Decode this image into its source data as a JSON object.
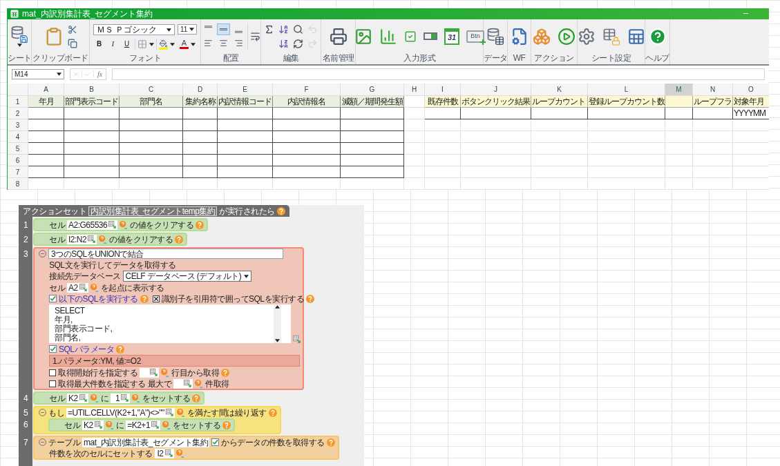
{
  "window": {
    "title": "mat_内訳別集計表_セグメント集約"
  },
  "ribbon": {
    "groups": [
      {
        "kind": "sheet",
        "label": "シート",
        "tools": [
          {
            "kind": "db_save"
          }
        ]
      },
      {
        "kind": "clipboard",
        "label": "クリップボード",
        "tools": [
          {
            "kind": "paste"
          },
          {
            "kind": "cut"
          },
          {
            "kind": "copy"
          }
        ]
      },
      {
        "kind": "font",
        "label": "フォント",
        "font_name": "ＭＳ Ｐゴシック",
        "font_size": "11",
        "styles": [
          "B",
          "I",
          "U"
        ],
        "font_color_glyph": "A"
      },
      {
        "kind": "align",
        "label": "配置",
        "alignments": [
          {
            "selected": false
          },
          {
            "selected": true
          },
          {
            "selected": false
          },
          {
            "selected": false
          },
          {
            "selected": false
          },
          {
            "selected": false
          }
        ]
      },
      {
        "kind": "edit",
        "label": "編集",
        "tools": [
          {
            "kind": "sum",
            "disabled": false
          },
          {
            "kind": "sort_asc",
            "disabled": false
          },
          {
            "kind": "find",
            "disabled": false
          },
          {
            "kind": "undo",
            "disabled": true
          },
          {
            "kind": "sort_desc",
            "disabled": false
          },
          {
            "kind": "refresh",
            "disabled": false
          },
          {
            "kind": "redo",
            "disabled": true
          }
        ]
      },
      {
        "kind": "names",
        "label": "名前管理",
        "tools": [
          {
            "kind": "names"
          }
        ]
      },
      {
        "kind": "input",
        "label": "入力形式",
        "tools": [
          {
            "kind": "image"
          },
          {
            "kind": "chart"
          },
          {
            "kind": "check"
          },
          {
            "kind": "combo"
          },
          {
            "kind": "calendar",
            "text": "31"
          },
          {
            "kind": "button",
            "text": "Btn"
          }
        ]
      },
      {
        "kind": "data",
        "label": "データ",
        "tools": [
          {
            "kind": "database"
          }
        ]
      },
      {
        "kind": "wf",
        "label": "WF",
        "tools": [
          {
            "kind": "workflow"
          }
        ]
      },
      {
        "kind": "action",
        "label": "アクション",
        "tools": [
          {
            "kind": "blocks"
          },
          {
            "kind": "run"
          }
        ]
      },
      {
        "kind": "sheet_settings",
        "label": "シート設定",
        "tools": [
          {
            "kind": "gears"
          },
          {
            "kind": "lock"
          },
          {
            "kind": "grid"
          }
        ]
      },
      {
        "kind": "help",
        "label": "ヘルプ",
        "tools": [
          {
            "kind": "help"
          }
        ]
      }
    ]
  },
  "formula_bar": {
    "name_box": "M14",
    "function_glyph": "fx"
  },
  "sheet": {
    "columns": [
      {
        "label": "A",
        "selected": false
      },
      {
        "label": "B",
        "selected": false
      },
      {
        "label": "C",
        "selected": false
      },
      {
        "label": "D",
        "selected": false
      },
      {
        "label": "E",
        "selected": false
      },
      {
        "label": "F",
        "selected": false
      },
      {
        "label": "G",
        "selected": false
      },
      {
        "label": "H",
        "selected": false
      },
      {
        "label": "I",
        "selected": false
      },
      {
        "label": "J",
        "selected": false
      },
      {
        "label": "K",
        "selected": false
      },
      {
        "label": "L",
        "selected": false
      },
      {
        "label": "M",
        "selected": true
      },
      {
        "label": "N",
        "selected": false
      },
      {
        "label": "O",
        "selected": false
      }
    ],
    "rows": [
      {
        "label": "1",
        "cells": [
          "年月",
          "部門表示コード",
          "部門名",
          "集約名称",
          "内訳情報コード",
          "内訳情報名",
          "減額／期間発生額",
          null,
          "既存件数",
          "ボタンクリック結果",
          "ループカウント",
          "登録ループカウント数",
          null,
          "ループフラ",
          "対象年月"
        ]
      },
      {
        "label": "2",
        "cells": [
          null,
          null,
          null,
          null,
          null,
          null,
          null,
          null,
          null,
          null,
          null,
          null,
          null,
          null,
          "YYYYMM"
        ]
      },
      {
        "label": "3"
      },
      {
        "label": "4"
      },
      {
        "label": "5"
      },
      {
        "label": "6"
      },
      {
        "label": "7"
      },
      {
        "label": "8"
      }
    ]
  },
  "action_set": {
    "prefix": "アクションセット",
    "name": "内訳別集計表_セグメントtemp集約",
    "suffix": "が実行されたら",
    "steps": [
      {
        "number": "1",
        "kind": "cell",
        "lines": [
          [
            {
              "kind": "text",
              "text": "セル"
            },
            {
              "kind": "field",
              "value": "A2:G65536"
            },
            {
              "kind": "text",
              "text": "の値をクリアする"
            },
            {
              "kind": "help"
            }
          ]
        ]
      },
      {
        "number": "2",
        "kind": "cell",
        "lines": [
          [
            {
              "kind": "text",
              "text": "セル"
            },
            {
              "kind": "field",
              "value": "I2:N2"
            },
            {
              "kind": "text",
              "text": "の値をクリアする"
            },
            {
              "kind": "help"
            }
          ]
        ]
      },
      {
        "number": "3",
        "kind": "sql",
        "collapsible": true,
        "lines": [
          [
            {
              "kind": "title",
              "value": "3つのSQLをUNIONで結合"
            }
          ],
          [
            {
              "kind": "text",
              "text": "SQL文を実行してデータを取得する"
            }
          ],
          [
            {
              "kind": "text",
              "text": "接続先データベース"
            },
            {
              "kind": "select",
              "value": "CELF データベース (デフォルト)"
            }
          ],
          [
            {
              "kind": "text",
              "text": "セル"
            },
            {
              "kind": "field",
              "value": "A2"
            },
            {
              "kind": "text",
              "text": "を起点に表示する"
            }
          ],
          [
            {
              "kind": "check",
              "text": "以下のSQLを実行する",
              "checked": true
            },
            {
              "kind": "help"
            },
            {
              "kind": "box_check",
              "text": "識別子を引用符で囲ってSQLを実行する",
              "checked": true
            },
            {
              "kind": "help"
            }
          ],
          [
            {
              "kind": "code",
              "lines": [
                "SELECT",
                "年月,",
                "部門表示コード,",
                "部門名,"
              ]
            }
          ],
          [
            {
              "kind": "check",
              "text": "SQLパラメータ",
              "checked": true
            },
            {
              "kind": "help"
            }
          ],
          [
            {
              "kind": "param",
              "text": "1.パラメータ:YM, 値:=O2"
            }
          ],
          [
            {
              "kind": "box_check",
              "text": "取得開始行を指定する",
              "checked": false
            },
            {
              "kind": "field"
            },
            {
              "kind": "text",
              "text": "行目から取得"
            },
            {
              "kind": "help"
            }
          ],
          [
            {
              "kind": "box_check",
              "text": "取得最大件数を指定する",
              "checked": false
            },
            {
              "kind": "text",
              "text": "最大で"
            },
            {
              "kind": "field"
            },
            {
              "kind": "text",
              "text": "件取得"
            }
          ]
        ]
      },
      {
        "number": "4",
        "kind": "cell",
        "lines": [
          [
            {
              "kind": "text",
              "text": "セル"
            },
            {
              "kind": "field",
              "value": "K2"
            },
            {
              "kind": "text",
              "text": "に"
            },
            {
              "kind": "field",
              "value": "1"
            },
            {
              "kind": "text",
              "text": "をセットする"
            },
            {
              "kind": "help"
            }
          ]
        ]
      },
      {
        "number": "5",
        "kind": "loop",
        "collapsible": true,
        "lines": [
          [
            {
              "kind": "text",
              "text": "もし"
            },
            {
              "kind": "field",
              "value": "=UTIL.CELLV(K2+1,\"A\")<>\"\""
            },
            {
              "kind": "text",
              "text": "を満たす間は繰り返す"
            },
            {
              "kind": "help"
            }
          ]
        ],
        "children": [
          {
            "number": "6",
            "kind": "cell",
            "lines": [
              [
                {
                  "kind": "text",
                  "text": "セル"
                },
                {
                  "kind": "field",
                  "value": "K2"
                },
                {
                  "kind": "text",
                  "text": "に"
                },
                {
                  "kind": "field",
                  "value": "=K2+1"
                },
                {
                  "kind": "text",
                  "text": "をセットする"
                },
                {
                  "kind": "help"
                }
              ]
            ]
          }
        ]
      },
      {
        "number": "7",
        "kind": "table",
        "collapsible": true,
        "lines": [
          [
            {
              "kind": "text",
              "text": "テーブル"
            },
            {
              "kind": "plain_field",
              "value": "mat_内訳別集計表_セグメント集約"
            },
            {
              "kind": "edit_icon"
            },
            {
              "kind": "text",
              "text": "からデータの件数を取得する"
            },
            {
              "kind": "help"
            }
          ],
          [
            {
              "kind": "text",
              "text": "件数を次のセルにセットする"
            },
            {
              "kind": "field",
              "value": "I2"
            }
          ]
        ]
      }
    ]
  }
}
